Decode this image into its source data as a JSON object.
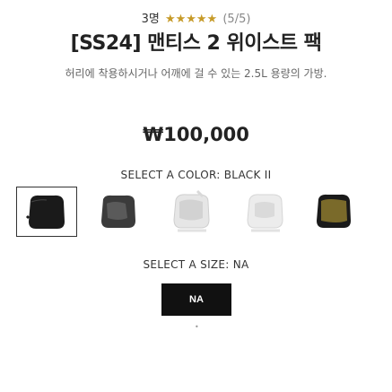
{
  "rating": {
    "count_text": "3명",
    "stars": "★★★★★",
    "score_text": "(5/5)"
  },
  "product": {
    "title": "[SS24] 맨티스 2 위이스트 팩",
    "description": "허리에 착용하시거나 어깨에 걸 수 있는 2.5L 용량의 가방.",
    "price": "₩100,000"
  },
  "color_selector": {
    "label": "SELECT A COLOR: BLACK II",
    "options": [
      {
        "name": "black-ii",
        "color": "#1a1a1a",
        "selected": true
      },
      {
        "name": "dark-gray",
        "color": "#3b3b3b",
        "selected": false
      },
      {
        "name": "light-gray",
        "color": "#d9d9d9",
        "selected": false
      },
      {
        "name": "silver",
        "color": "#cfcfcf",
        "selected": false
      },
      {
        "name": "olive",
        "color": "#7a6a2a",
        "selected": false
      }
    ]
  },
  "size_selector": {
    "label": "SELECT A SIZE: NA",
    "options": [
      "NA"
    ],
    "selected": "NA"
  },
  "colors": {
    "star": "#c69a28",
    "button_bg": "#111111"
  }
}
